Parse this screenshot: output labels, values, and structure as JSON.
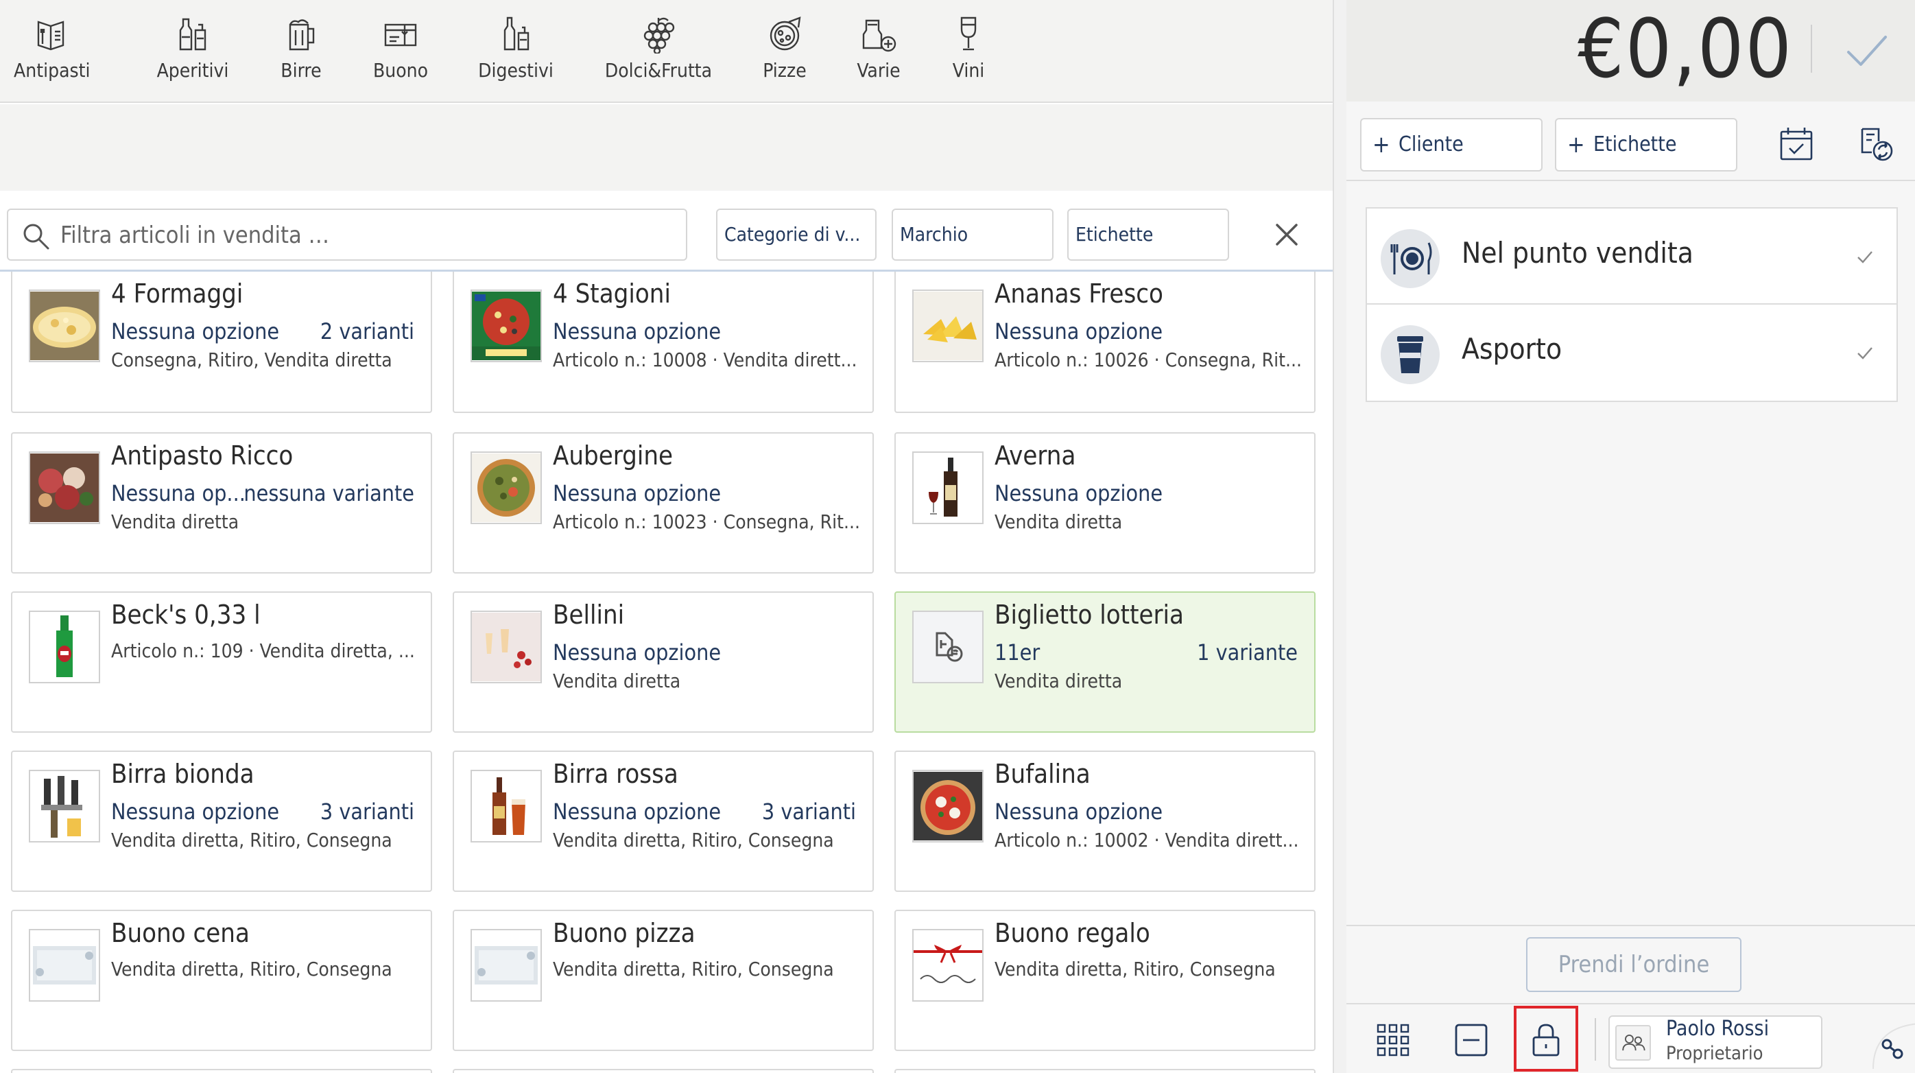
{
  "categories": [
    {
      "label": "Antipasti",
      "icon": "antipasti-menu-icon"
    },
    {
      "label": "Aperitivi",
      "icon": "aperitivi-bottles-icon"
    },
    {
      "label": "Birre",
      "icon": "beer-mug-icon"
    },
    {
      "label": "Buono",
      "icon": "voucher-icon"
    },
    {
      "label": "Digestivi",
      "icon": "digestivi-bottles-icon"
    },
    {
      "label": "Dolci&Frutta",
      "icon": "grapes-icon"
    },
    {
      "label": "Pizze",
      "icon": "pizza-icon"
    },
    {
      "label": "Varie",
      "icon": "misc-items-icon"
    },
    {
      "label": "Vini",
      "icon": "wine-glass-icon"
    }
  ],
  "filter": {
    "search_placeholder": "Filtra articoli in vendita …",
    "category_filter": "Categorie di v...",
    "brand_filter": "Marchio",
    "tags_filter": "Etichette"
  },
  "products": [
    {
      "name": "4 Formaggi",
      "option": "Nessuna opzione",
      "variants": "2 varianti",
      "meta": "Consegna, Ritiro, Vendita diretta"
    },
    {
      "name": "4 Stagioni",
      "option": "Nessuna opzione",
      "variants": "",
      "meta": "Articolo n.: 10008 · Vendita dirett..."
    },
    {
      "name": "Ananas Fresco",
      "option": "Nessuna opzione",
      "variants": "",
      "meta": "Articolo n.: 10026 · Consegna, Rit..."
    },
    {
      "name": "Antipasto Ricco",
      "option": "Nessuna op...",
      "variants": "nessuna variante",
      "meta": "Vendita diretta"
    },
    {
      "name": "Aubergine",
      "option": "Nessuna opzione",
      "variants": "",
      "meta": "Articolo n.: 10023 · Consegna, Rit..."
    },
    {
      "name": "Averna",
      "option": "Nessuna opzione",
      "variants": "",
      "meta": "Vendita diretta"
    },
    {
      "name": "Beck's 0,33 l",
      "option": "",
      "variants": "",
      "meta": "Articolo n.: 109 · Vendita diretta, ..."
    },
    {
      "name": "Bellini",
      "option": "Nessuna opzione",
      "variants": "",
      "meta": "Vendita diretta"
    },
    {
      "name": "Biglietto lotteria",
      "option": "11er",
      "variants": "1 variante",
      "meta": "Vendita diretta"
    },
    {
      "name": "Birra bionda",
      "option": "Nessuna opzione",
      "variants": "3 varianti",
      "meta": "Vendita diretta, Ritiro, Consegna"
    },
    {
      "name": "Birra rossa",
      "option": "Nessuna opzione",
      "variants": "3 varianti",
      "meta": "Vendita diretta, Ritiro, Consegna"
    },
    {
      "name": "Bufalina",
      "option": "Nessuna opzione",
      "variants": "",
      "meta": "Articolo n.: 10002 · Vendita dirett..."
    },
    {
      "name": "Buono cena",
      "option": "",
      "variants": "",
      "meta": "Vendita diretta, Ritiro, Consegna"
    },
    {
      "name": "Buono pizza",
      "option": "",
      "variants": "",
      "meta": "Vendita diretta, Ritiro, Consegna"
    },
    {
      "name": "Buono regalo",
      "option": "",
      "variants": "",
      "meta": "Vendita diretta, Ritiro, Consegna"
    }
  ],
  "order": {
    "total": "€0,00",
    "customer_button": "Cliente",
    "tags_button": "Etichette",
    "destinations": [
      {
        "label": "Nel punto vendita",
        "icon": "dine-in-plate-icon"
      },
      {
        "label": "Asporto",
        "icon": "takeaway-cup-icon"
      }
    ],
    "take_order_button": "Prendi l’ordine"
  },
  "user": {
    "name": "Paolo Rossi",
    "role": "Proprietario"
  },
  "colors": {
    "accent_text": "#23395d",
    "highlight_card": "#eef7e6",
    "lock_outline": "#e0262b"
  }
}
